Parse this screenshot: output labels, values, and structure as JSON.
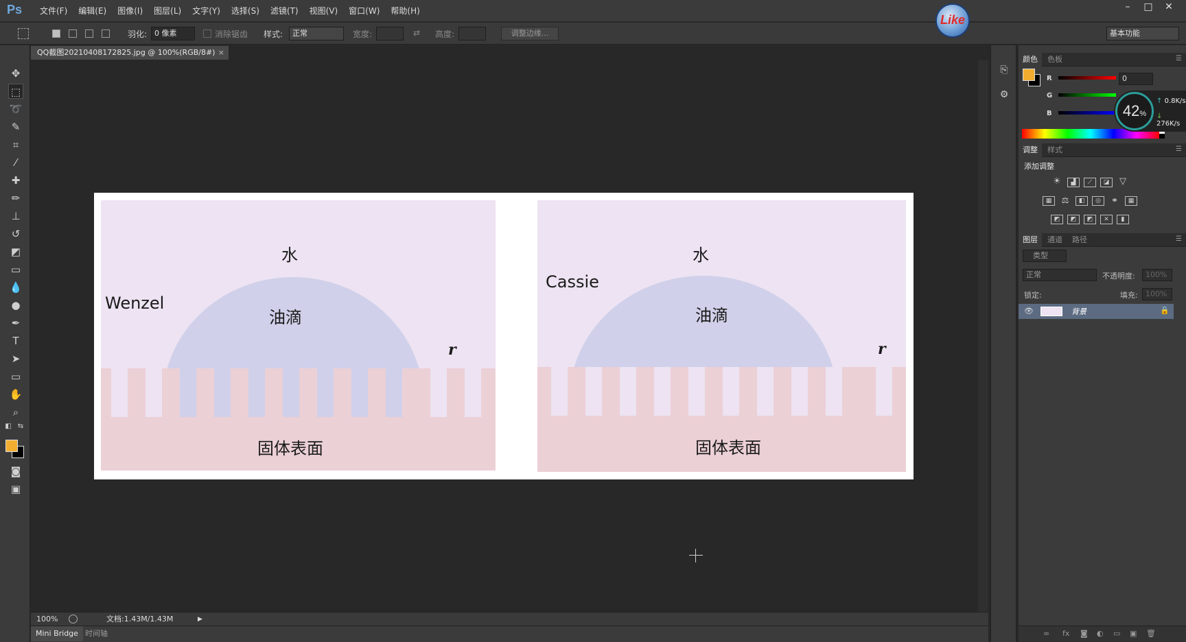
{
  "app": {
    "logo": "Ps",
    "badge": "Like",
    "menu": [
      "文件(F)",
      "编辑(E)",
      "图像(I)",
      "图层(L)",
      "文字(Y)",
      "选择(S)",
      "滤镜(T)",
      "视图(V)",
      "窗口(W)",
      "帮助(H)"
    ],
    "window_controls": [
      "–",
      "□",
      "✕"
    ]
  },
  "options_bar": {
    "feather_label": "羽化:",
    "feather_value": "0 像素",
    "antialias_label": "消除锯齿",
    "style_label": "样式:",
    "style_value": "正常",
    "width_label": "宽度:",
    "height_label": "高度:",
    "refine_edge_label": "调整边缘...",
    "workspace": "基本功能"
  },
  "document": {
    "tab_title": "QQ截图20210408172825.jpg @ 100%(RGB/8#)",
    "tab_close": "×"
  },
  "image": {
    "left_panel": {
      "water": "水",
      "droplet": "油滴",
      "model": "Wenzel",
      "r": "r",
      "surface": "固体表面"
    },
    "right_panel": {
      "water": "水",
      "droplet": "油滴",
      "model": "Cassie",
      "r": "r",
      "surface": "固体表面"
    },
    "colors": {
      "water": "#ede3f2",
      "droplet": "#d0d0ea",
      "solid": "#ebd0d6"
    }
  },
  "status": {
    "zoom": "100%",
    "doc_size": "文档:1.43M/1.43M"
  },
  "bottom_tabs": [
    "Mini Bridge",
    "时间轴"
  ],
  "panels": {
    "color": {
      "tabs": [
        "颜色",
        "色板"
      ],
      "r_label": "R",
      "g_label": "G",
      "b_label": "B",
      "r_value": "0",
      "foreground": "#f2ad30",
      "background": "#000000"
    },
    "perf": {
      "percent": "42",
      "percent_sign": "%",
      "up": "0.8K/s",
      "down": "276K/s"
    },
    "adjustments": {
      "tabs": [
        "调整",
        "样式"
      ],
      "title": "添加调整"
    },
    "layers": {
      "tabs": [
        "图层",
        "通道",
        "路径"
      ],
      "filter_label": "类型",
      "blend_mode": "正常",
      "opacity_label": "不透明度:",
      "opacity_value": "100%",
      "lock_label": "锁定:",
      "fill_label": "填充:",
      "fill_value": "100%",
      "layer_name": "背景"
    }
  }
}
